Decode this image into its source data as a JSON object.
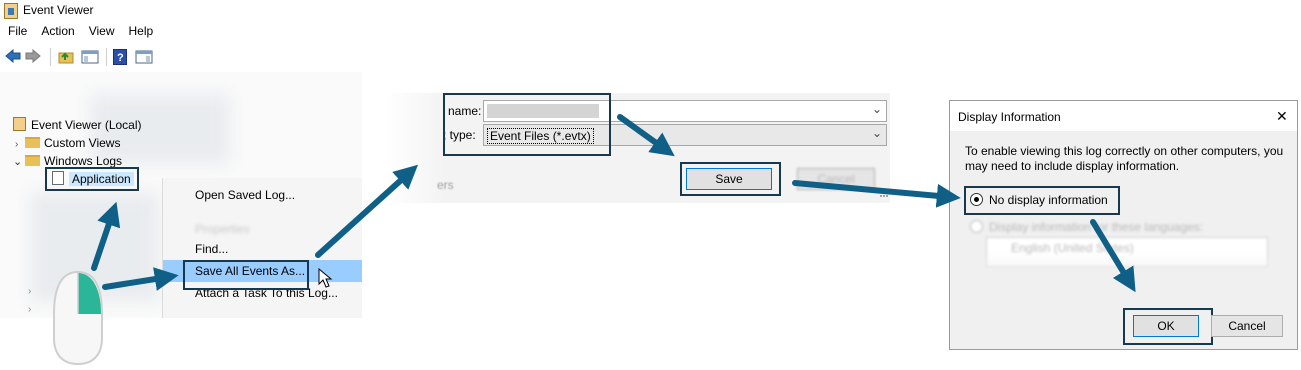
{
  "event_viewer": {
    "title": "Event Viewer",
    "menu": [
      "File",
      "Action",
      "View",
      "Help"
    ],
    "tree": {
      "root": "Event Viewer (Local)",
      "custom_views": "Custom Views",
      "windows_logs": "Windows Logs",
      "application": "Application"
    },
    "context_menu": {
      "open_saved_log": "Open Saved Log...",
      "properties": "Properties",
      "find": "Find...",
      "save_all_events_as": "Save All Events As...",
      "attach_task": "Attach a Task To this Log..."
    }
  },
  "save_dialog": {
    "file_name_label": "name:",
    "save_type_label": "; type:",
    "save_type_value": "Event Files (*.evtx)",
    "folders_fragment": "ers",
    "save_button": "Save",
    "cancel_button": "Cancel"
  },
  "display_info_dialog": {
    "title": "Display Information",
    "close_glyph": "✕",
    "message": "To enable viewing this log correctly on other computers, you may need to include display information.",
    "option_none": "No display information",
    "option_languages": "Display information for these languages:",
    "language_item": "English (United States)",
    "ok_button": "OK",
    "cancel_button": "Cancel"
  },
  "colors": {
    "highlight_border": "#17394f",
    "arrow": "#0f5f87",
    "menu_selection": "#99ccff",
    "mouse_button": "#2bb69a"
  }
}
